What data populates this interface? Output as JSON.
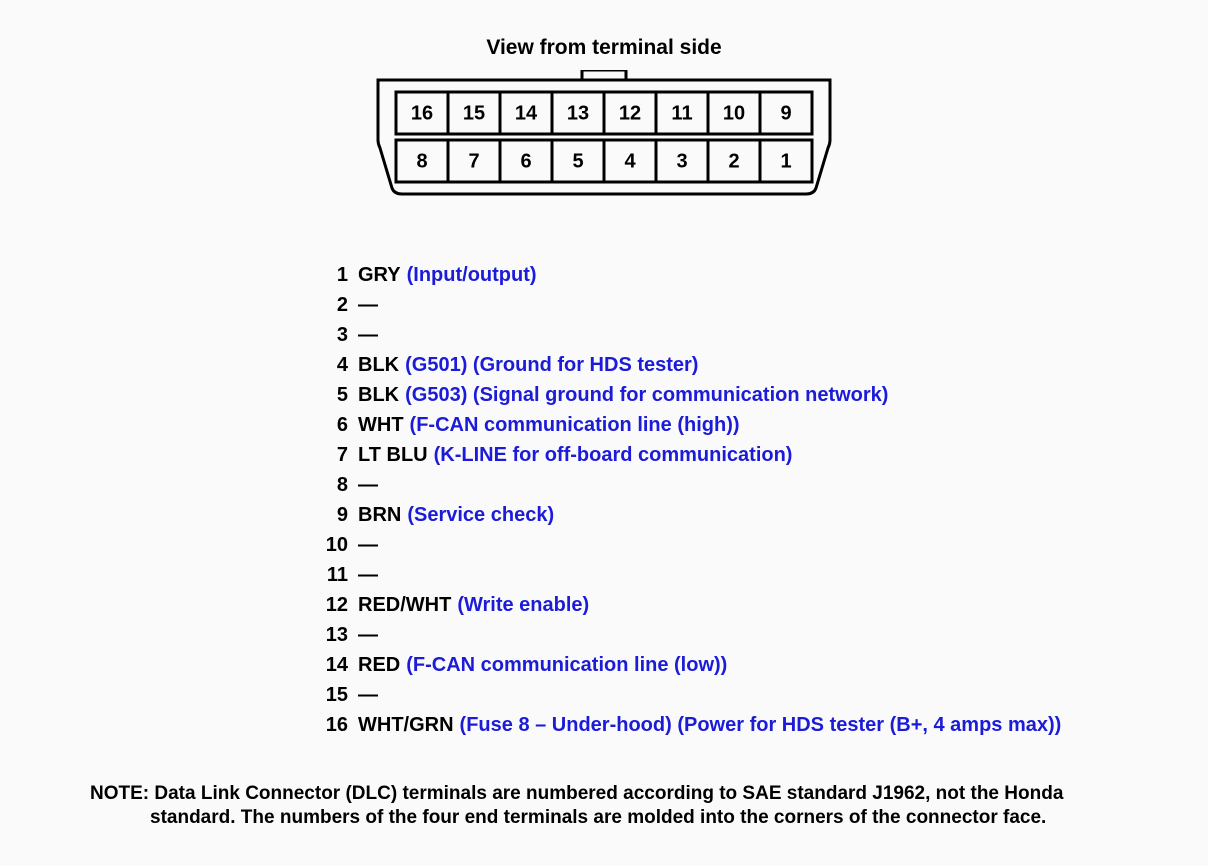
{
  "title": "View from terminal side",
  "connector": {
    "top_row": [
      "16",
      "15",
      "14",
      "13",
      "12",
      "11",
      "10",
      "9"
    ],
    "bottom_row": [
      "8",
      "7",
      "6",
      "5",
      "4",
      "3",
      "2",
      "1"
    ]
  },
  "pins": [
    {
      "num": "1",
      "color": "GRY",
      "desc": "(Input/output)"
    },
    {
      "num": "2",
      "color": "",
      "desc": ""
    },
    {
      "num": "3",
      "color": "",
      "desc": ""
    },
    {
      "num": "4",
      "color": "BLK",
      "desc": "(G501) (Ground for HDS tester)"
    },
    {
      "num": "5",
      "color": "BLK",
      "desc": "(G503) (Signal ground for communication network)"
    },
    {
      "num": "6",
      "color": "WHT",
      "desc": "(F-CAN communication line (high))"
    },
    {
      "num": "7",
      "color": "LT BLU",
      "desc": "(K-LINE for off-board communication)"
    },
    {
      "num": "8",
      "color": "",
      "desc": ""
    },
    {
      "num": "9",
      "color": "BRN",
      "desc": "(Service check)"
    },
    {
      "num": "10",
      "color": "",
      "desc": ""
    },
    {
      "num": "11",
      "color": "",
      "desc": ""
    },
    {
      "num": "12",
      "color": "RED/WHT",
      "desc": "(Write enable)"
    },
    {
      "num": "13",
      "color": "",
      "desc": ""
    },
    {
      "num": "14",
      "color": "RED",
      "desc": "(F-CAN communication line (low))"
    },
    {
      "num": "15",
      "color": "",
      "desc": ""
    },
    {
      "num": "16",
      "color": "WHT/GRN",
      "desc": "(Fuse 8 – Under-hood) (Power for HDS tester (B+, 4 amps max))"
    }
  ],
  "note_label": "NOTE:",
  "note_line1": "Data Link Connector (DLC) terminals are numbered according to SAE standard J1962, not the Honda",
  "note_line2": "standard. The numbers of the four end terminals are molded into the corners of the connector face.",
  "dash": "—"
}
